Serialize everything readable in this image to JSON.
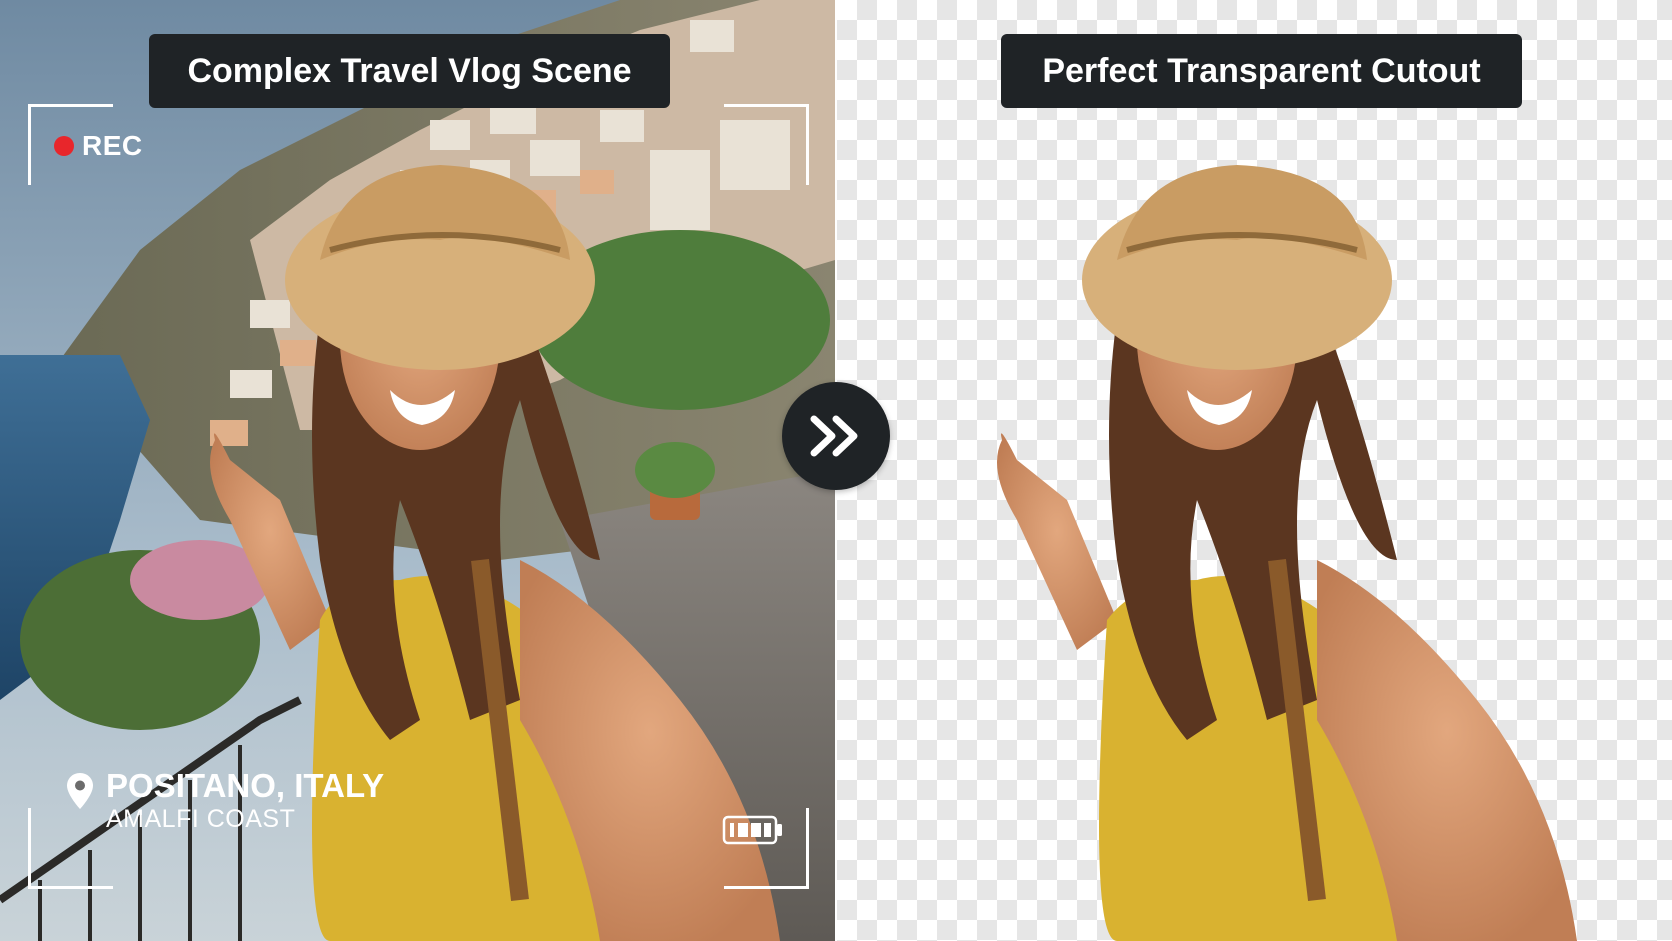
{
  "panels": {
    "left_label": "Complex Travel Vlog Scene",
    "right_label": "Perfect Transparent Cutout"
  },
  "camera_overlay": {
    "rec_label": "REC",
    "location_title": "POSITANO, ITALY",
    "location_subtitle": "AMALFI COAST",
    "icons": [
      "record-dot-icon",
      "location-pin-icon",
      "battery-icon"
    ]
  },
  "compare_button": {
    "icon": "double-chevron-right-icon"
  },
  "colors": {
    "label_bg": "#1f2326",
    "rec_red": "#e8262b",
    "dress_yellow": "#d9b230",
    "hat_straw": "#d7b07a",
    "sea_blue": "#2f5f86"
  }
}
